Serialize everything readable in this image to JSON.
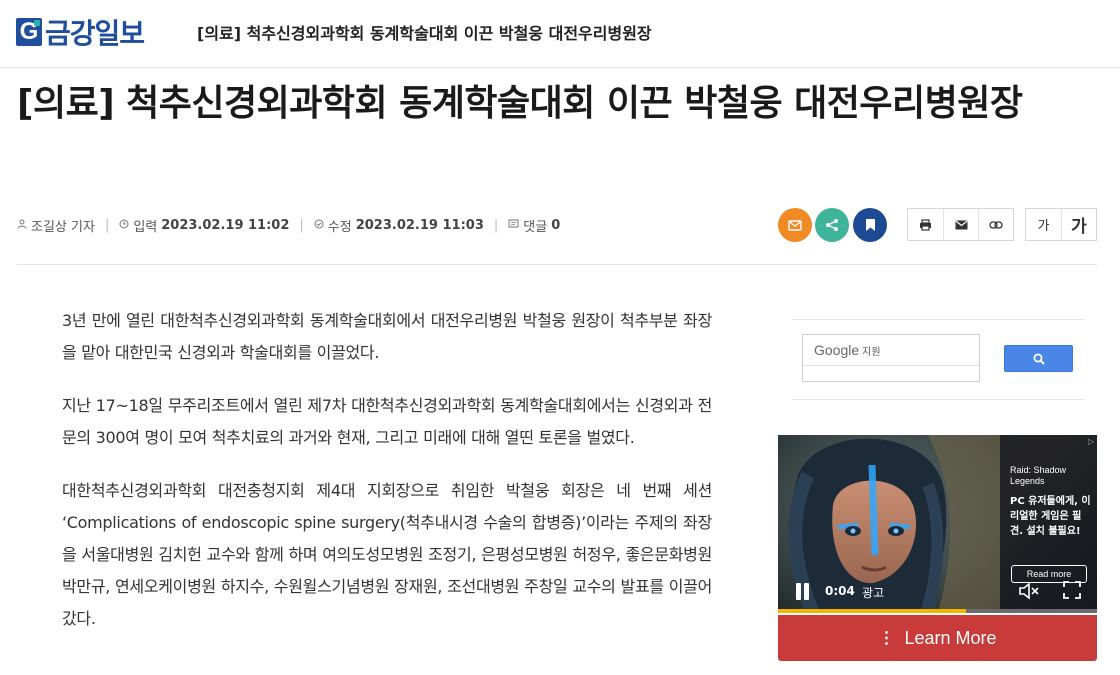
{
  "site": {
    "logo_letter": "G",
    "logo_name": "금강일보",
    "brand_color": "#1f4f9c"
  },
  "header": {
    "sticky_headline": "[의료] 척추신경외과학회 동계학술대회 이끈 박철웅 대전우리병원장"
  },
  "article": {
    "headline": "[의료] 척추신경외과학회 동계학술대회 이끈 박철웅 대전우리병원장",
    "meta": {
      "author": "조길상 기자",
      "posted_label": "입력",
      "posted_at": "2023.02.19 11:02",
      "modified_label": "수정",
      "modified_at": "2023.02.19 11:03",
      "comments_label": "댓글",
      "comments_count": "0"
    },
    "paragraphs": [
      "3년 만에 열린 대한척추신경외과학회 동계학술대회에서 대전우리병원 박철웅 원장이 척추부분 좌장을 맡아 대한민국 신경외과 학술대회를 이끌었다.",
      "지난 17~18일 무주리조트에서 열린 제7차 대한척추신경외과학회 동계학술대회에서는 신경외과 전문의 300여 명이 모여 척추치료의 과거와 현재, 그리고 미래에 대해 열띤 토론을 벌였다.",
      "대한척추신경외과학회 대전충청지회 제4대 지회장으로 취임한 박철웅 회장은 네 번째 세션 ‘Complications of endoscopic spine surgery(척추내시경 수술의 합병증)’이라는 주제의 좌장을 서울대병원 김치헌 교수와 함께 하며 여의도성모병원 조정기, 은평성모병원 허정우, 좋은문화병원 박만규, 연세오케이병원 하지수, 수원윌스기념병원 장재원, 조선대병원 주창일 교수의 발표를 이끌어 갔다."
    ]
  },
  "toolbar": {
    "share_icons": [
      "mail-icon",
      "share-icon",
      "bookmark-icon"
    ],
    "share_colors": {
      "mail": "#ef8a24",
      "share": "#3fb49a",
      "bookmark": "#1d4a93"
    },
    "tools": [
      "print-icon",
      "email-icon",
      "link-icon"
    ],
    "font_small": "가",
    "font_large": "가"
  },
  "sidebar": {
    "search": {
      "brand": "Google",
      "brand_sub": "지원"
    },
    "ad": {
      "title": "Raid: Shadow Legends",
      "description": "PC 유저들에게, 이 리얼한 게임은 필견. 설치 불필요!",
      "read_more": "Read more",
      "time": "0:04",
      "label": "광고",
      "progress": 0.59,
      "cta": "Learn More",
      "cta_color": "#c93b3b"
    }
  }
}
